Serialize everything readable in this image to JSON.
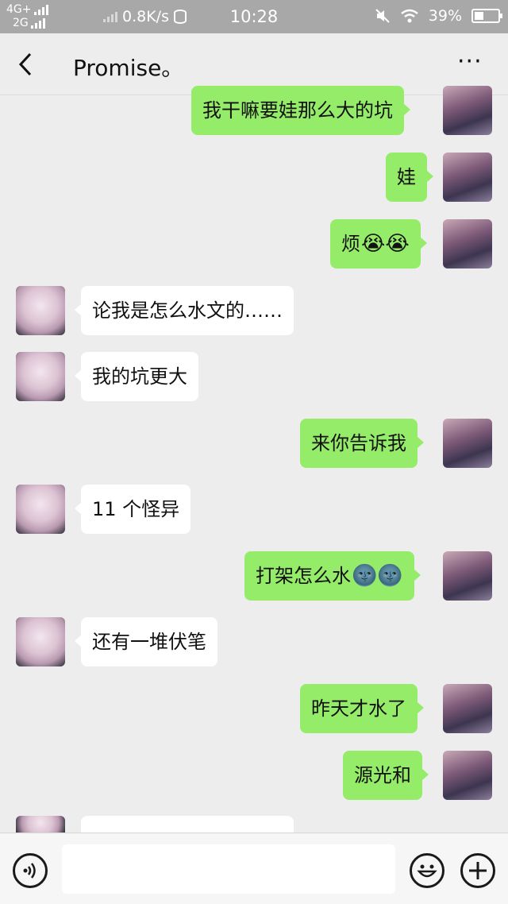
{
  "status_bar": {
    "network_top": "4G+",
    "network_bottom": "2G",
    "speed": "0.8K/s",
    "time": "10:28",
    "battery": "39%"
  },
  "header": {
    "title": "Promise。"
  },
  "messages": [
    {
      "side": "self",
      "text": "我干嘛要娃那么大的坑"
    },
    {
      "side": "self",
      "text": "娃"
    },
    {
      "side": "self",
      "text": "烦",
      "emoji": "😭😭"
    },
    {
      "side": "other",
      "text": "论我是怎么水文的……"
    },
    {
      "side": "other",
      "text": "我的坑更大"
    },
    {
      "side": "self",
      "text": "来你告诉我"
    },
    {
      "side": "other",
      "text": "11 个怪异"
    },
    {
      "side": "self",
      "text": "打架怎么水",
      "emoji": "🌚🌚"
    },
    {
      "side": "other",
      "text": "还有一堆伏笔"
    },
    {
      "side": "self",
      "text": "昨天才水了"
    },
    {
      "side": "self",
      "text": "源光和"
    }
  ],
  "icons": {
    "back": "chevron-left-icon",
    "more": "more-dots-icon",
    "voice": "voice-icon",
    "emoji": "smiley-icon",
    "plus": "plus-icon"
  }
}
